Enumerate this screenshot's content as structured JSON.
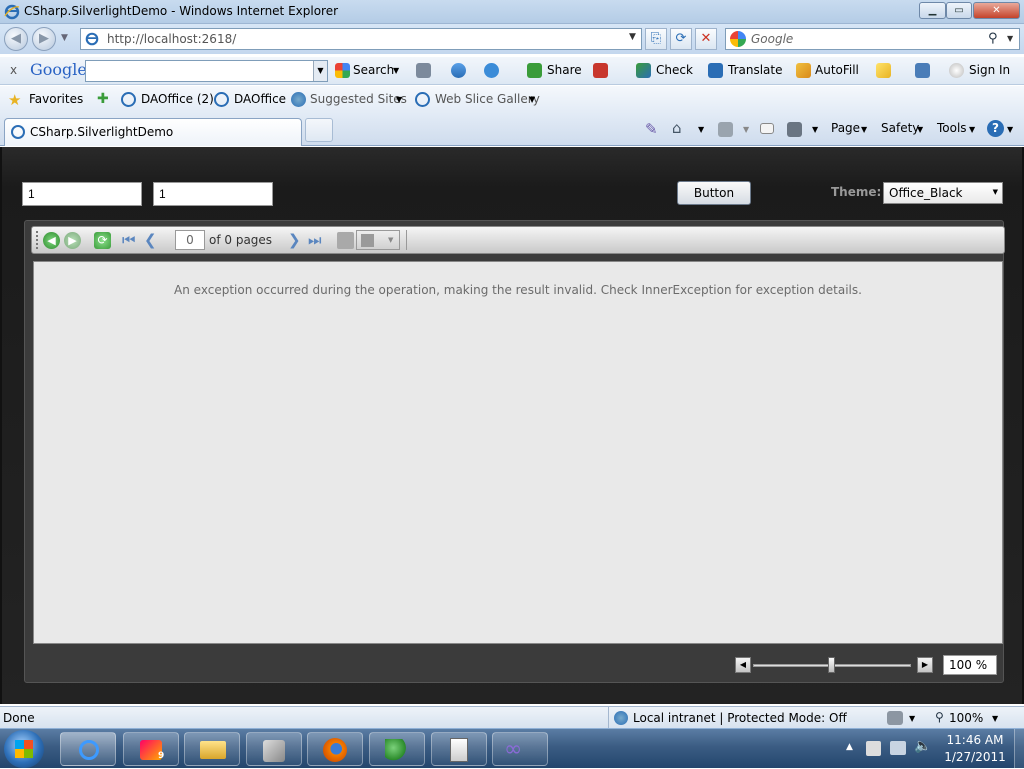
{
  "window": {
    "title": "CSharp.SilverlightDemo - Windows Internet Explorer",
    "minimize": "▁",
    "maximize": "▭",
    "close": "✕"
  },
  "address": {
    "url": "http://localhost:2618/",
    "search_placeholder": "Google"
  },
  "google_toolbar": {
    "close": "x",
    "logo": "Google",
    "search_label": "Search",
    "share_label": "Share",
    "check_label": "Check",
    "translate_label": "Translate",
    "autofill_label": "AutoFill",
    "signin_label": "Sign In"
  },
  "favorites_bar": {
    "favorites_label": "Favorites",
    "items": [
      "DAOffice (2)",
      "DAOffice",
      "Suggested Sites",
      "Web Slice Gallery"
    ]
  },
  "tabs": {
    "active": "CSharp.SilverlightDemo"
  },
  "command_bar": {
    "page_label": "Page",
    "safety_label": "Safety",
    "tools_label": "Tools",
    "help": "?"
  },
  "app": {
    "input1": "1",
    "input2": "1",
    "button_label": "Button",
    "theme_label": "Theme:",
    "theme_value": "Office_Black",
    "pager": {
      "page": "0",
      "of_text": "of 0 pages"
    },
    "error_message": "An exception occurred during the operation, making the result invalid.  Check InnerException for exception details.",
    "zoom": "100 %",
    "zoom_level": 0.5
  },
  "status": {
    "left": "Done",
    "zone": "Local intranet | Protected Mode: Off",
    "zoom": "100%"
  },
  "taskbar": {
    "time": "11:46 AM",
    "date": "1/27/2011",
    "badge": "9"
  },
  "colors": {
    "accent": "#2a6db5",
    "google_green": "#3a9c3a",
    "error_text": "#6b6b6b"
  }
}
